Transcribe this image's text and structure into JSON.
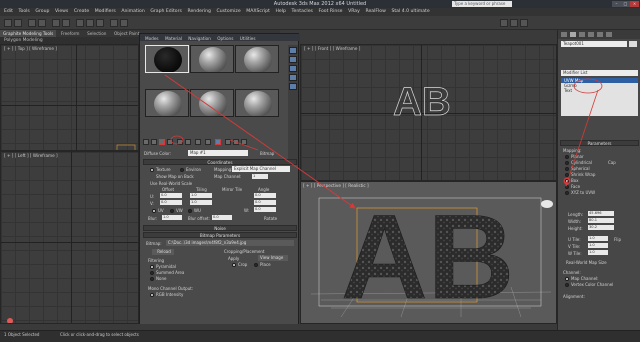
{
  "window": {
    "title": "Autodesk 3ds Max  2012 x64     Untitled",
    "search_placeholder": "Type a keyword or phrase"
  },
  "menubar": [
    "Edit",
    "Tools",
    "Group",
    "Views",
    "Create",
    "Modifiers",
    "Animation",
    "Graph Editors",
    "Rendering",
    "Customize",
    "MAXScript",
    "Help",
    "Tentacles",
    "Foot Rinse",
    "VRay",
    "RealFlow",
    "Stal 4.0 ultimate"
  ],
  "ribbon_tabs": [
    "Graphite Modeling Tools",
    "Freeform",
    "Selection",
    "Object Paint"
  ],
  "ribbon_subtitle": "Polygon Modeling",
  "viewports": {
    "top": "[ + ] [ Top ] [ Wireframe ]",
    "front": "[ + ] [ Front ] [ Wireframe ]",
    "left": "[ + ] [ Left ] [ Wireframe ]",
    "perspective": "[ + ] [ Perspective ] [ Realistic ]",
    "wire_text": "AB",
    "persp_text": "AB"
  },
  "material_editor": {
    "menus": [
      "Modes",
      "Material",
      "Navigation",
      "Options",
      "Utilities"
    ],
    "slot_count": 6,
    "material_name_label": "Diffuse Color:",
    "material_name": "Map #1",
    "material_type": "Bitmap",
    "coordinates": {
      "title": "Coordinates",
      "texture": "Texture",
      "environ": "Environ",
      "mapping_label": "Mapping:",
      "mapping_value": "Explicit Map Channel",
      "show_map_on_back": "Show Map on Back",
      "map_channel_label": "Map Channel:",
      "map_channel_value": "1",
      "use_real_world": "Use Real-World Scale",
      "offset": "Offset",
      "tiling": "Tiling",
      "mirror_tile": "Mirror Tile",
      "angle": "Angle",
      "u": "U:",
      "v": "V:",
      "w": "W:",
      "u_offset": "0.0",
      "v_offset": "0.0",
      "u_tiling": "1.0",
      "v_tiling": "1.0",
      "u_angle": "0.0",
      "v_angle": "0.0",
      "w_angle": "0.0",
      "uv": "UV",
      "vw": "VW",
      "wu": "WU",
      "blur_label": "Blur:",
      "blur": "1.0",
      "blur_offset_label": "Blur offset:",
      "blur_offset": "0.0",
      "rotate": "Rotate"
    },
    "noise": "Noise",
    "bitmap_params": {
      "title": "Bitmap Parameters",
      "bitmap_label": "Bitmap:",
      "bitmap_path": "C:\\Doc..\\3d images\\m4f8f2_n3a9e4.jpg",
      "reload": "Reload",
      "cropping_title": "Cropping/Placement",
      "apply": "Apply",
      "view_image": "View Image",
      "crop": "Crop",
      "place": "Place",
      "filtering_title": "Filtering",
      "pyramidal": "Pyramidal",
      "summed_area": "Summed Area",
      "none": "None",
      "mono_title": "Mono Channel Output:",
      "rgb_intensity": "RGB Intensity"
    }
  },
  "command_panel": {
    "object_name": "Teapot001",
    "modifier_list": "Modifier List",
    "stack": [
      "UVW Map",
      "Gizmo",
      "Text"
    ],
    "parameters_title": "Parameters",
    "mapping_title": "Mapping:",
    "mapping_options": [
      "Planar",
      "Cylindrical",
      "Spherical",
      "Shrink Wrap",
      "Box",
      "Face",
      "XYZ to UVW"
    ],
    "cap_label": "Cap",
    "selected_mapping": "Box",
    "length_label": "Length:",
    "length": "45.696",
    "width_label": "Width:",
    "width": "80.1",
    "height_label": "Height:",
    "height": "30.2",
    "utile_label": "U Tile:",
    "utile": "1.0",
    "vtile_label": "V Tile:",
    "vtile": "1.0",
    "wtile_label": "W Tile:",
    "wtile": "1.0",
    "flip": "Flip",
    "real_world": "Real-World Map Size",
    "channel_title": "Channel:",
    "map_channel": "Map Channel:",
    "vertex_color": "Vertex Color Channel",
    "alignment_title": "Alignment:"
  },
  "status": {
    "left": "1 Object Selected",
    "hint": "Click or click-and-drag to select objects"
  },
  "colors": {
    "arrow": "#d33a3a",
    "selection": "#2f5fa3",
    "gizmo": "#e0a030"
  }
}
